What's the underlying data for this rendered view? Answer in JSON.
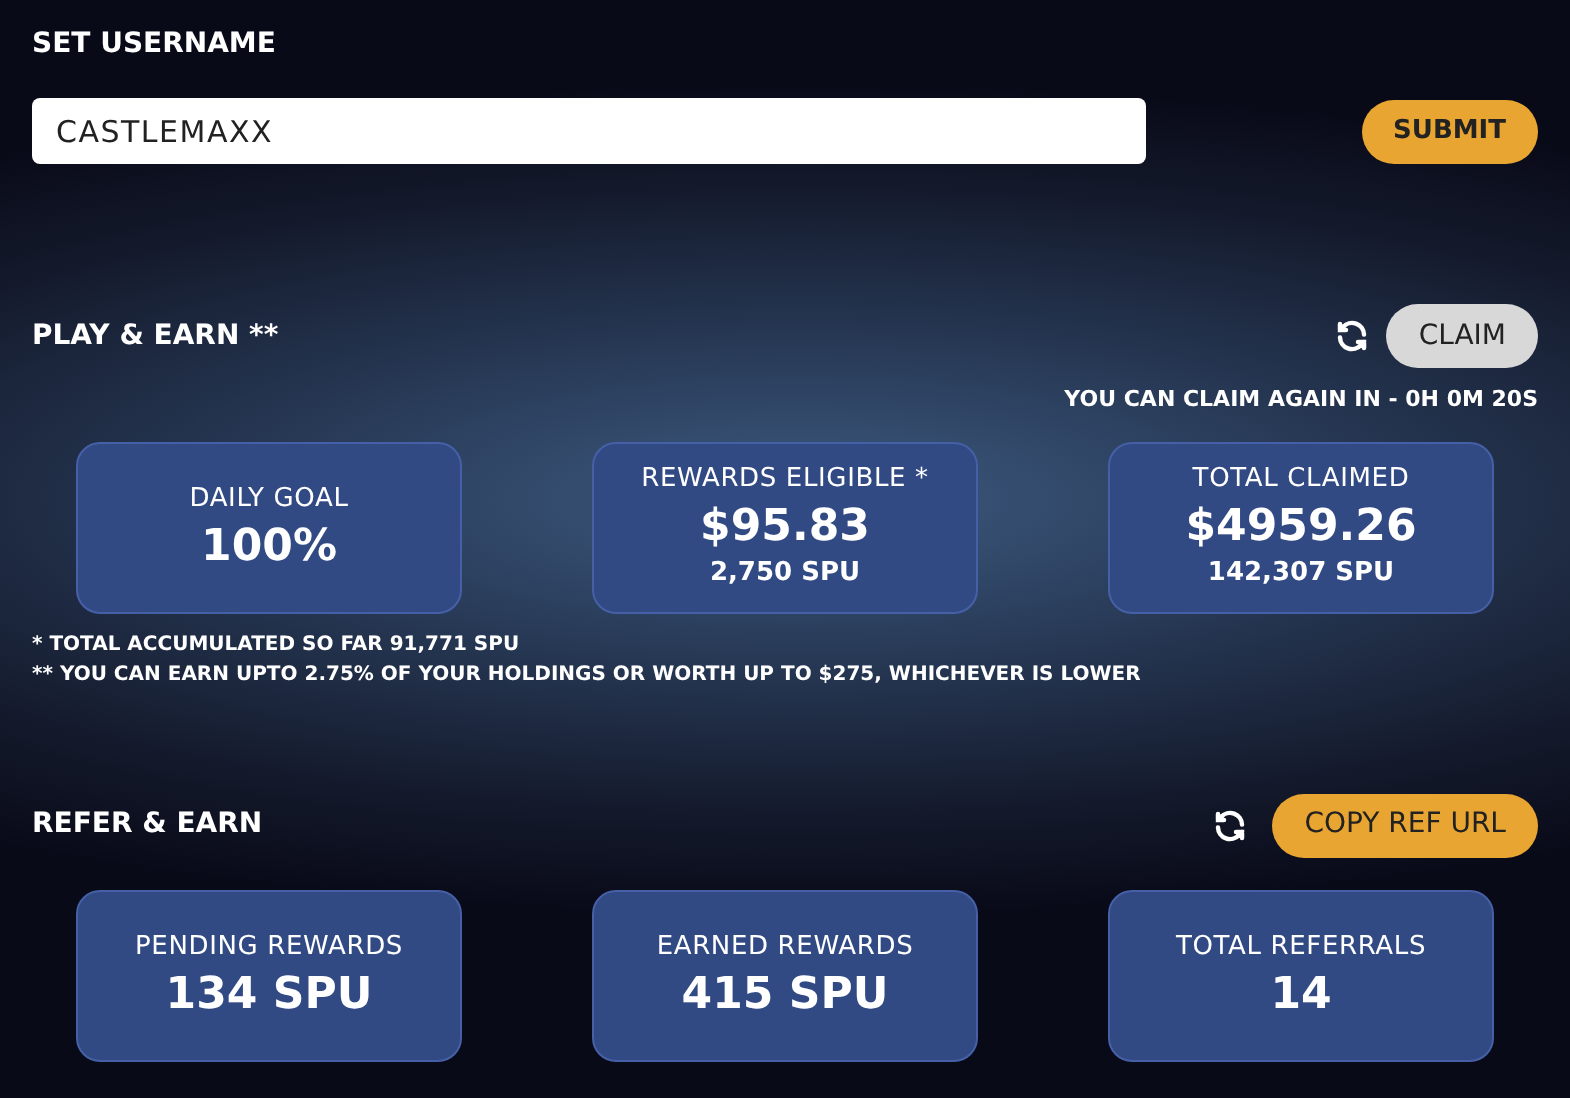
{
  "username": {
    "label": "SET USERNAME",
    "value": "CASTLEMAXX",
    "button": "SUBMIT"
  },
  "play": {
    "title": "PLAY & EARN **",
    "button": "CLAIM",
    "countdown": "YOU CAN CLAIM AGAIN IN - 0H 0M 20S",
    "cards": [
      {
        "label": "DAILY GOAL",
        "value": "100%"
      },
      {
        "label": "REWARDS ELIGIBLE *",
        "value": "$95.83",
        "sub": "2,750 SPU"
      },
      {
        "label": "TOTAL CLAIMED",
        "value": "$4959.26",
        "sub": "142,307 SPU"
      }
    ],
    "notes": [
      "* TOTAL ACCUMULATED SO FAR 91,771 SPU",
      "** YOU CAN EARN UPTO 2.75% OF YOUR HOLDINGS OR WORTH UP TO $275, WHICHEVER IS LOWER"
    ]
  },
  "refer": {
    "title": "REFER & EARN",
    "button": "COPY REF URL",
    "cards": [
      {
        "label": "PENDING REWARDS",
        "value": "134 SPU"
      },
      {
        "label": "EARNED REWARDS",
        "value": "415 SPU"
      },
      {
        "label": "TOTAL REFERRALS",
        "value": "14"
      }
    ]
  }
}
